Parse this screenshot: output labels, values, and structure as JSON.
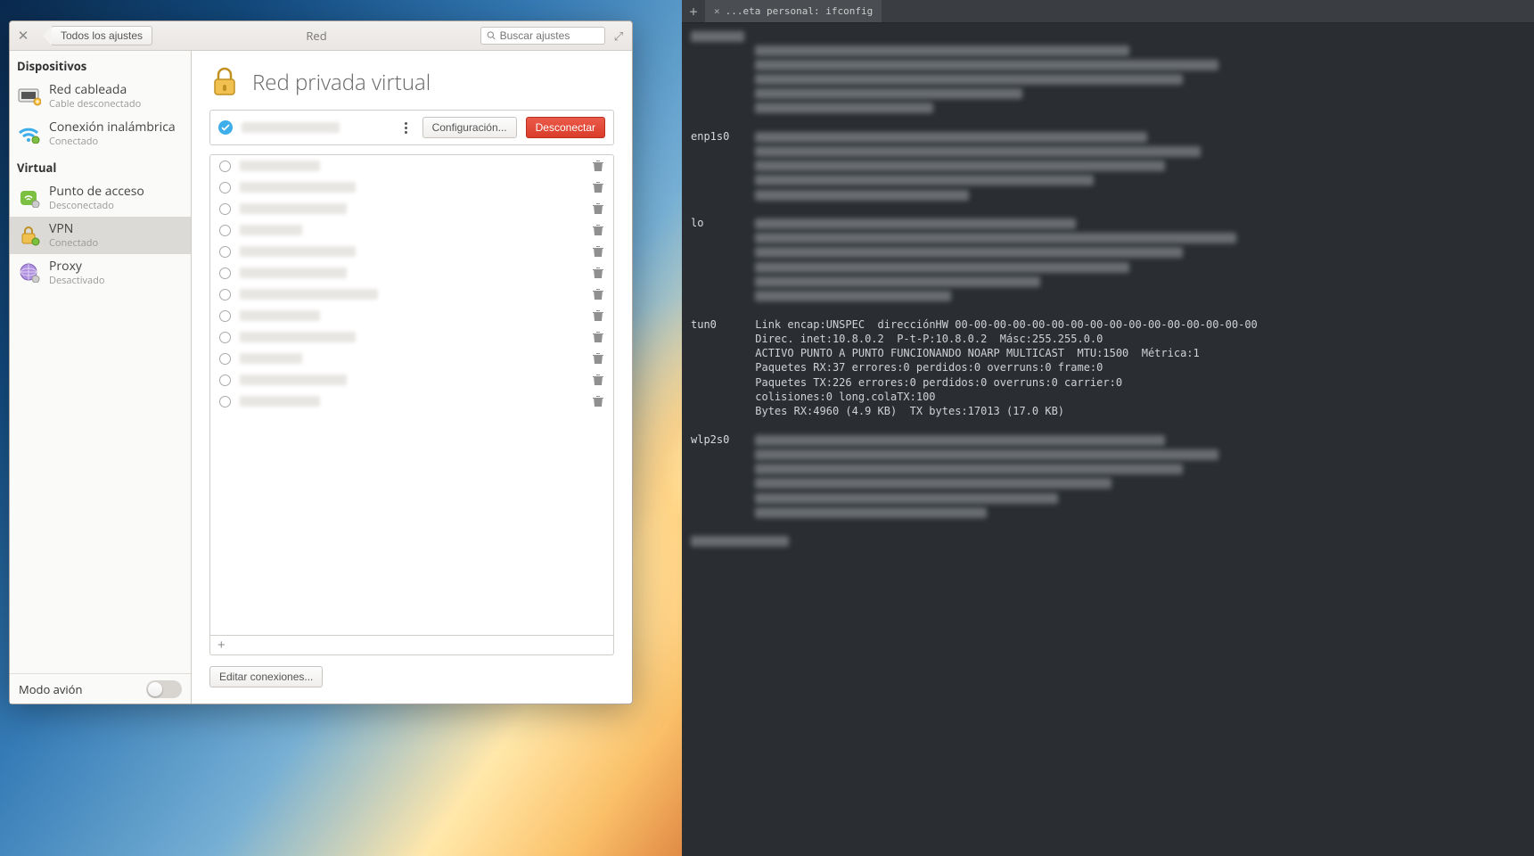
{
  "settings": {
    "titlebar": {
      "back_label": "Todos los ajustes",
      "title": "Red",
      "search_placeholder": "Buscar ajustes"
    },
    "sidebar": {
      "section_devices": "Dispositivos",
      "section_virtual": "Virtual",
      "items": [
        {
          "id": "wired",
          "label": "Red cableada",
          "sub": "Cable desconectado"
        },
        {
          "id": "wifi",
          "label": "Conexión inalámbrica",
          "sub": "Conectado"
        },
        {
          "id": "hotspot",
          "label": "Punto de acceso",
          "sub": "Desconectado"
        },
        {
          "id": "vpn",
          "label": "VPN",
          "sub": "Conectado"
        },
        {
          "id": "proxy",
          "label": "Proxy",
          "sub": "Desactivado"
        }
      ],
      "airplane_label": "Modo avión"
    },
    "main": {
      "title": "Red privada virtual",
      "config_btn": "Configuración...",
      "disconnect_btn": "Desconectar",
      "edit_btn": "Editar conexiones...",
      "vpn_entries_count": 12
    }
  },
  "terminal": {
    "tab_title": "...eta personal: ifconfig",
    "interfaces": [
      "enp1s0",
      "lo",
      "tun0",
      "wlp2s0"
    ],
    "tun0_lines": [
      "Link encap:UNSPEC  direcciónHW 00-00-00-00-00-00-00-00-00-00-00-00-00-00-00-00",
      "Direc. inet:10.8.0.2  P-t-P:10.8.0.2  Másc:255.255.0.0",
      "ACTIVO PUNTO A PUNTO FUNCIONANDO NOARP MULTICAST  MTU:1500  Métrica:1",
      "Paquetes RX:37 errores:0 perdidos:0 overruns:0 frame:0",
      "Paquetes TX:226 errores:0 perdidos:0 overruns:0 carrier:0",
      "colisiones:0 long.colaTX:100",
      "Bytes RX:4960 (4.9 KB)  TX bytes:17013 (17.0 KB)"
    ]
  }
}
